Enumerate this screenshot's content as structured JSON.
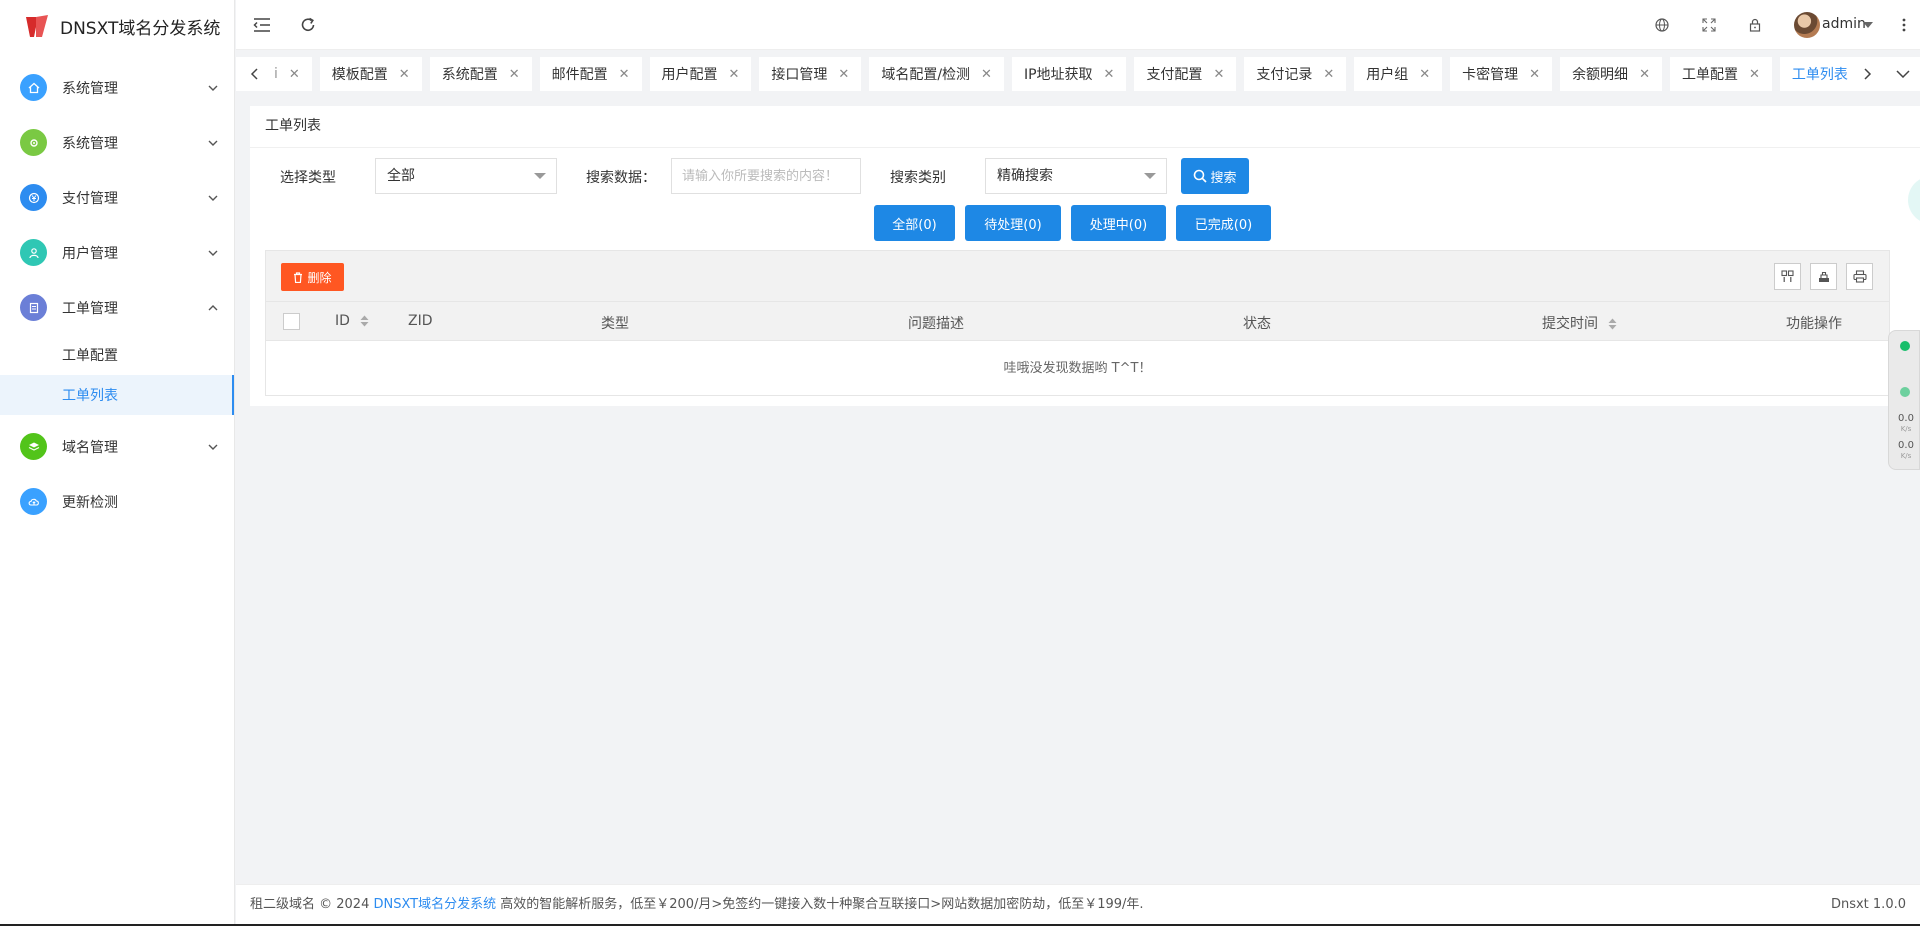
{
  "app": {
    "title": "DNSXT域名分发系统"
  },
  "sidebar": {
    "items": [
      {
        "label": "系统管理",
        "icon": "home-icon",
        "color": "#3aa1ff",
        "expanded": false
      },
      {
        "label": "系统管理",
        "icon": "gear-icon",
        "color": "#7ac943",
        "expanded": false
      },
      {
        "label": "支付管理",
        "icon": "pay-icon",
        "color": "#2d8cf0",
        "expanded": false
      },
      {
        "label": "用户管理",
        "icon": "user-icon",
        "color": "#2fc7b4",
        "expanded": false
      },
      {
        "label": "工单管理",
        "icon": "ticket-icon",
        "color": "#6b7fd7",
        "expanded": true
      },
      {
        "label": "域名管理",
        "icon": "layers-icon",
        "color": "#52c41a",
        "expanded": false
      },
      {
        "label": "更新检测",
        "icon": "cloud-icon",
        "color": "#3aa1ff",
        "expanded": false
      }
    ],
    "sub_items": [
      {
        "label": "工单配置",
        "active": false
      },
      {
        "label": "工单列表",
        "active": true
      }
    ]
  },
  "header": {
    "user": "admin"
  },
  "tabs": [
    {
      "label": "i",
      "active": false
    },
    {
      "label": "模板配置",
      "active": false
    },
    {
      "label": "系统配置",
      "active": false
    },
    {
      "label": "邮件配置",
      "active": false
    },
    {
      "label": "用户配置",
      "active": false
    },
    {
      "label": "接口管理",
      "active": false
    },
    {
      "label": "域名配置/检测",
      "active": false
    },
    {
      "label": "IP地址获取",
      "active": false
    },
    {
      "label": "支付配置",
      "active": false
    },
    {
      "label": "支付记录",
      "active": false
    },
    {
      "label": "用户组",
      "active": false
    },
    {
      "label": "卡密管理",
      "active": false
    },
    {
      "label": "余额明细",
      "active": false
    },
    {
      "label": "工单配置",
      "active": false
    },
    {
      "label": "工单列表",
      "active": true
    }
  ],
  "page": {
    "title": "工单列表",
    "filter": {
      "type_label": "选择类型",
      "type_value": "全部",
      "search_label": "搜索数据：",
      "search_placeholder": "请输入你所要搜索的内容！",
      "search_value": "",
      "category_label": "搜索类别",
      "category_value": "精确搜索",
      "search_button": "搜索"
    },
    "status_buttons": [
      {
        "label": "全部(0)"
      },
      {
        "label": "待处理(0)"
      },
      {
        "label": "处理中(0)"
      },
      {
        "label": "已完成(0)"
      }
    ],
    "toolbar": {
      "delete_label": "删除"
    },
    "table": {
      "columns": [
        "ID",
        "ZID",
        "类型",
        "问题描述",
        "状态",
        "提交时间",
        "功能操作"
      ],
      "empty_text": "哇哦没发现数据哟 T^T！"
    }
  },
  "footer": {
    "prefix": "租二级域名 © 2024 ",
    "link": "DNSXT域名分发系统",
    "suffix": " 高效的智能解析服务，低至￥200/月>免签约一键接入数十种聚合互联接口>网站数据加密防劫，低至￥199/年.",
    "version": "Dnsxt 1.0.0"
  },
  "net_widget": {
    "upload": "0.0",
    "download": "0.0",
    "unit": "K/s"
  },
  "colors": {
    "primary": "#1e88e5",
    "danger": "#ff5722",
    "active_tab": "#2d8cf0"
  }
}
